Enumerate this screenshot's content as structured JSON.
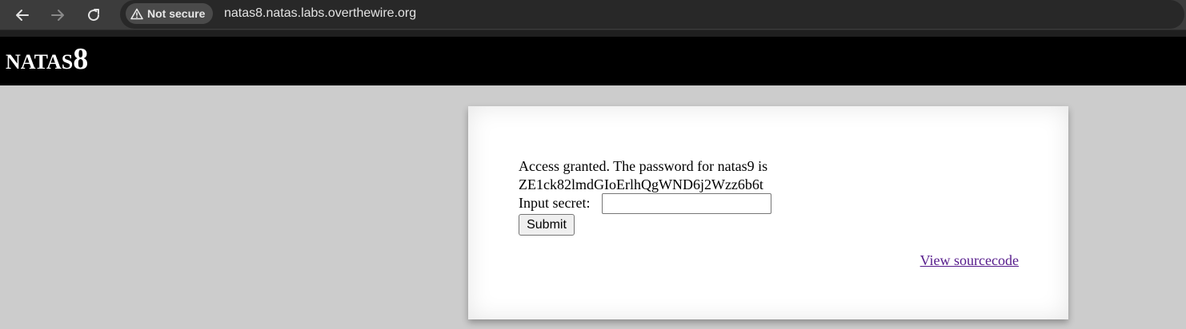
{
  "browser": {
    "security_label": "Not secure",
    "url": "natas8.natas.labs.overthewire.org",
    "icons": {
      "back": "arrow-left-icon",
      "forward": "arrow-right-icon",
      "reload": "reload-icon",
      "security": "warning-triangle-icon"
    }
  },
  "header": {
    "title_prefix": "NATAS",
    "title_number": "8"
  },
  "content": {
    "message_line1": "Access granted. The password for natas9 is",
    "message_line2": "ZE1ck82lmdGIoErlhQgWND6j2Wzz6b6t",
    "input_label": "Input secret:",
    "input_value": "",
    "input_placeholder": "",
    "submit_label": "Submit",
    "source_link_label": "View sourcecode"
  },
  "colors": {
    "page_background": "#cccccc",
    "header_background": "#000000",
    "card_background": "#ffffff",
    "link_visited": "#551a8b"
  }
}
